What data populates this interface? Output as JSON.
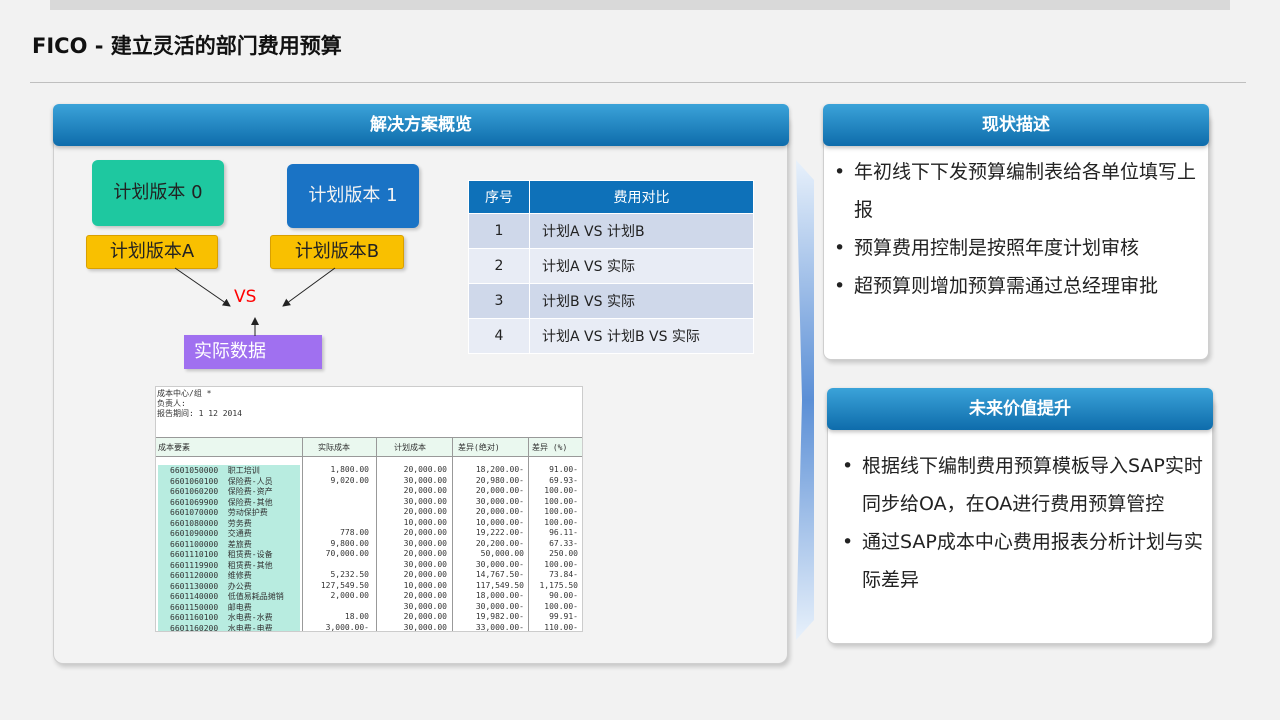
{
  "title": "FICO - 建立灵活的部门费用预算",
  "solution": {
    "header": "解决方案概览",
    "plan0": "计划版本 0",
    "plan1": "计划版本 1",
    "planA": "计划版本A",
    "planB": "计划版本B",
    "vs": "VS",
    "actual": "实际数据",
    "table": {
      "headers": [
        "序号",
        "费用对比"
      ],
      "rows": [
        [
          "1",
          "计划A VS 计划B"
        ],
        [
          "2",
          "计划A VS 实际"
        ],
        [
          "3",
          "计划B VS 实际"
        ],
        [
          "4",
          "计划A VS 计划B VS 实际"
        ]
      ]
    },
    "report": {
      "meta": [
        "成本中心/组           *",
        "负责人:",
        "报告期间:              1        12  2014"
      ],
      "columns": [
        "成本要素",
        "实际成本",
        "计划成本",
        "差异(绝对)",
        "差异 (%)"
      ],
      "rows": [
        [
          "6601050000  职工培训",
          "1,800.00",
          "20,000.00",
          "18,200.00-",
          "91.00-"
        ],
        [
          "6601060100  保险费-人员",
          "9,020.00",
          "30,000.00",
          "20,980.00-",
          "69.93-"
        ],
        [
          "6601060200  保险费-资产",
          "",
          "20,000.00",
          "20,000.00-",
          "100.00-"
        ],
        [
          "6601069900  保险费-其他",
          "",
          "30,000.00",
          "30,000.00-",
          "100.00-"
        ],
        [
          "6601070000  劳动保护费",
          "",
          "20,000.00",
          "20,000.00-",
          "100.00-"
        ],
        [
          "6601080000  劳务费",
          "",
          "10,000.00",
          "10,000.00-",
          "100.00-"
        ],
        [
          "6601090000  交通费",
          "778.00",
          "20,000.00",
          "19,222.00-",
          "96.11-"
        ],
        [
          "6601100000  差旅费",
          "9,800.00",
          "30,000.00",
          "20,200.00-",
          "67.33-"
        ],
        [
          "6601110100  租赁费-设备",
          "70,000.00",
          "20,000.00",
          "50,000.00",
          "250.00"
        ],
        [
          "6601119900  租赁费-其他",
          "",
          "30,000.00",
          "30,000.00-",
          "100.00-"
        ],
        [
          "6601120000  维修费",
          "5,232.50",
          "20,000.00",
          "14,767.50-",
          "73.84-"
        ],
        [
          "6601130000  办公费",
          "127,549.50",
          "10,000.00",
          "117,549.50",
          "1,175.50"
        ],
        [
          "6601140000  低值易耗品摊销",
          "2,000.00",
          "20,000.00",
          "18,000.00-",
          "90.00-"
        ],
        [
          "6601150000  邮电费",
          "",
          "30,000.00",
          "30,000.00-",
          "100.00-"
        ],
        [
          "6601160100  水电费-水费",
          "18.00",
          "20,000.00",
          "19,982.00-",
          "99.91-"
        ],
        [
          "6601160200  水电费-电费",
          "3,000.00-",
          "30,000.00",
          "33,000.00-",
          "110.00-"
        ]
      ]
    }
  },
  "status": {
    "header": "现状描述",
    "items": [
      "年初线下下发预算编制表给各单位填写上报",
      "预算费用控制是按照年度计划审核",
      "超预算则增加预算需通过总经理审批"
    ]
  },
  "future": {
    "header": "未来价值提升",
    "items": [
      "根据线下编制费用预算模板导入SAP实时同步给OA，在OA进行费用预算管控",
      "通过SAP成本中心费用报表分析计划与实际差异"
    ]
  },
  "colors": {
    "header_blue": "#0e6cab",
    "plan0": "#1ec8a0",
    "plan1": "#1a73c5",
    "tag_yellow": "#f9c000",
    "actual_purple": "#a070f0",
    "vs_red": "#ff0000",
    "table_header": "#0e71b9"
  }
}
